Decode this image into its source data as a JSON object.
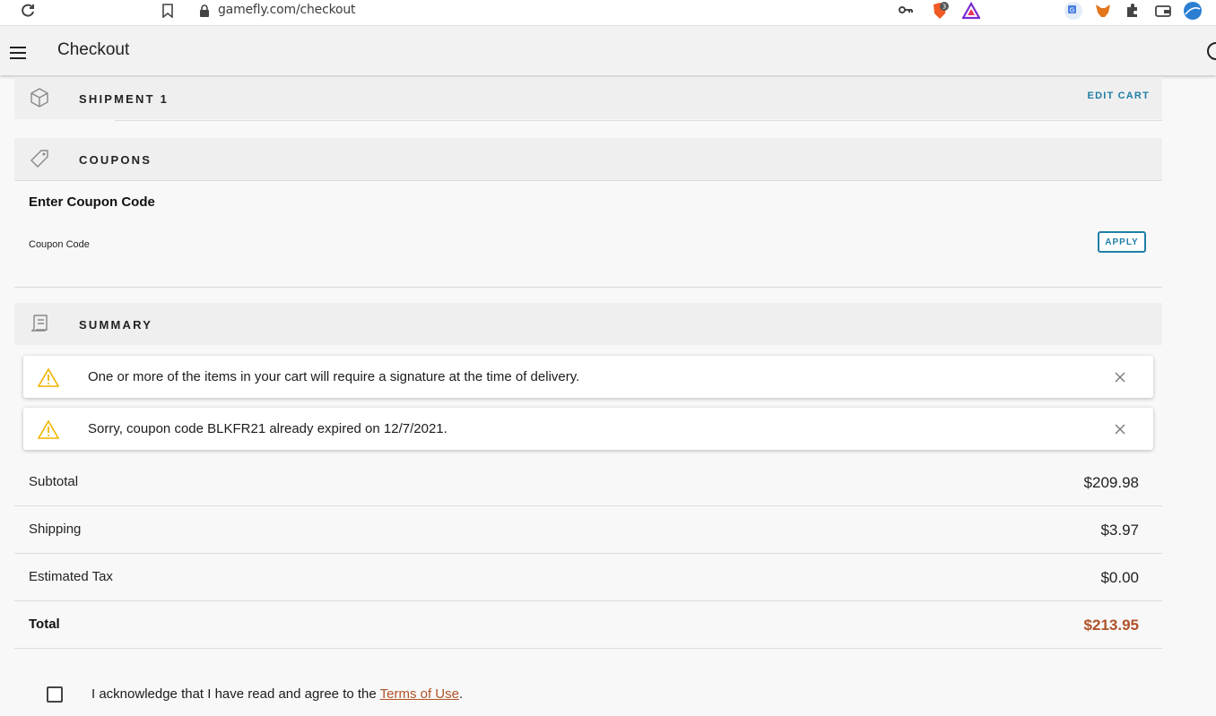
{
  "browser": {
    "url": "gamefly.com/checkout",
    "brave_badge": "3"
  },
  "header": {
    "title": "Checkout"
  },
  "shipment": {
    "title": "SHIPMENT 1",
    "edit_cart": "EDIT CART"
  },
  "coupons": {
    "title": "COUPONS",
    "heading": "Enter Coupon Code",
    "field_label": "Coupon Code",
    "field_value": "",
    "apply_label": "APPLY"
  },
  "summary": {
    "title": "SUMMARY"
  },
  "alerts": [
    {
      "text": "One or more of the items in your cart will require a signature at the time of delivery."
    },
    {
      "text": "Sorry, coupon code BLKFR21 already expired on 12/7/2021."
    }
  ],
  "totals": {
    "subtotal_label": "Subtotal",
    "subtotal_value": "$209.98",
    "shipping_label": "Shipping",
    "shipping_value": "$3.97",
    "tax_label": "Estimated Tax",
    "tax_value": "$0.00",
    "total_label": "Total",
    "total_value": "$213.95"
  },
  "terms": {
    "prefix": "I acknowledge that I have read and agree to the ",
    "link": "Terms of Use",
    "suffix": ".",
    "checked": false
  },
  "colors": {
    "accent": "#1f7fa6",
    "total": "#b0532a",
    "warning": "#f0b400"
  }
}
